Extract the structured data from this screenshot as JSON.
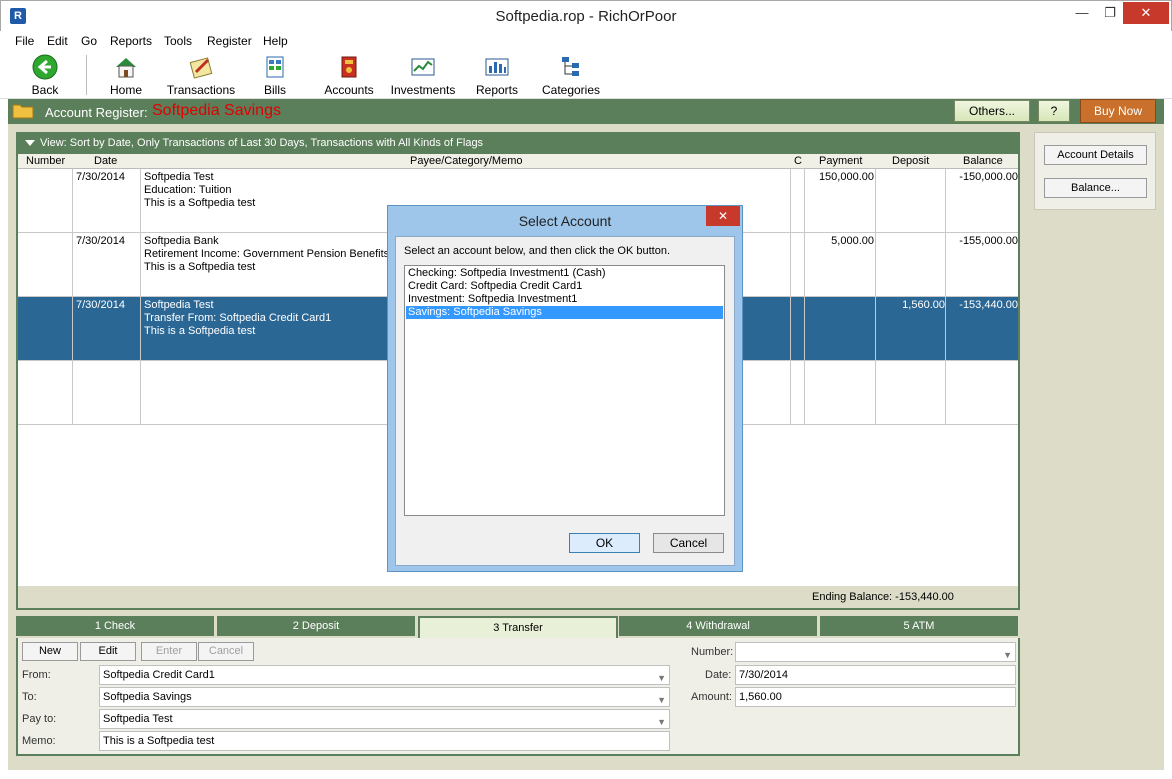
{
  "window": {
    "app_icon": "R",
    "title": "Softpedia.rop - RichOrPoor",
    "minimize": "—",
    "maximize": "❐",
    "close": "✕"
  },
  "menu": [
    "File",
    "Edit",
    "Go",
    "Reports",
    "Tools",
    "Register",
    "Help"
  ],
  "toolbar": {
    "back": "Back",
    "home": "Home",
    "transactions": "Transactions",
    "bills": "Bills",
    "accounts": "Accounts",
    "investments": "Investments",
    "reports": "Reports",
    "categories": "Categories"
  },
  "account_header": {
    "label": "Account Register:",
    "name": "Softpedia Savings",
    "others": "Others...",
    "help": "?",
    "buy_now": "Buy Now"
  },
  "register": {
    "view": "View: Sort by Date, Only Transactions of Last 30 Days, Transactions with All Kinds of Flags",
    "columns": {
      "number": "Number",
      "date": "Date",
      "payee": "Payee/Category/Memo",
      "c": "C",
      "payment": "Payment",
      "deposit": "Deposit",
      "balance": "Balance"
    },
    "rows": [
      {
        "date": "7/30/2014",
        "payee": "Softpedia Test",
        "category": "Education: Tuition",
        "memo": "This is a Softpedia test",
        "payment": "150,000.00",
        "deposit": "",
        "balance": "-150,000.00"
      },
      {
        "date": "7/30/2014",
        "payee": "Softpedia Bank",
        "category": "Retirement Income: Government Pension Benefits",
        "memo": "This is a Softpedia test",
        "payment": "5,000.00",
        "deposit": "",
        "balance": "-155,000.00"
      },
      {
        "date": "7/30/2014",
        "payee": "Softpedia Test",
        "category": "Transfer From: Softpedia Credit Card1",
        "memo": "This is a Softpedia test",
        "payment": "",
        "deposit": "1,560.00",
        "balance": "-153,440.00"
      }
    ],
    "ending_balance": "Ending Balance:  -153,440.00"
  },
  "side_panel": {
    "account_details": "Account Details",
    "balance": "Balance..."
  },
  "tabs": [
    "1 Check",
    "2 Deposit",
    "3 Transfer",
    "4 Withdrawal",
    "5 ATM"
  ],
  "form": {
    "new": "New",
    "edit": "Edit",
    "enter": "Enter",
    "cancel": "Cancel",
    "from_label": "From:",
    "from_value": "Softpedia Credit Card1",
    "to_label": "To:",
    "to_value": "Softpedia Savings",
    "payto_label": "Pay to:",
    "payto_value": "Softpedia Test",
    "memo_label": "Memo:",
    "memo_value": "This is a Softpedia test",
    "number_label": "Number:",
    "number_value": "",
    "date_label": "Date:",
    "date_value": "7/30/2014",
    "amount_label": "Amount:",
    "amount_value": "1,560.00"
  },
  "dialog": {
    "title": "Select Account",
    "close": "✕",
    "instruction": "Select an account below, and then click the OK button.",
    "items": [
      "Checking: Softpedia Investment1 (Cash)",
      "Credit Card: Softpedia Credit Card1",
      "Investment: Softpedia Investment1",
      "Savings: Softpedia Savings"
    ],
    "ok": "OK",
    "cancel": "Cancel"
  }
}
